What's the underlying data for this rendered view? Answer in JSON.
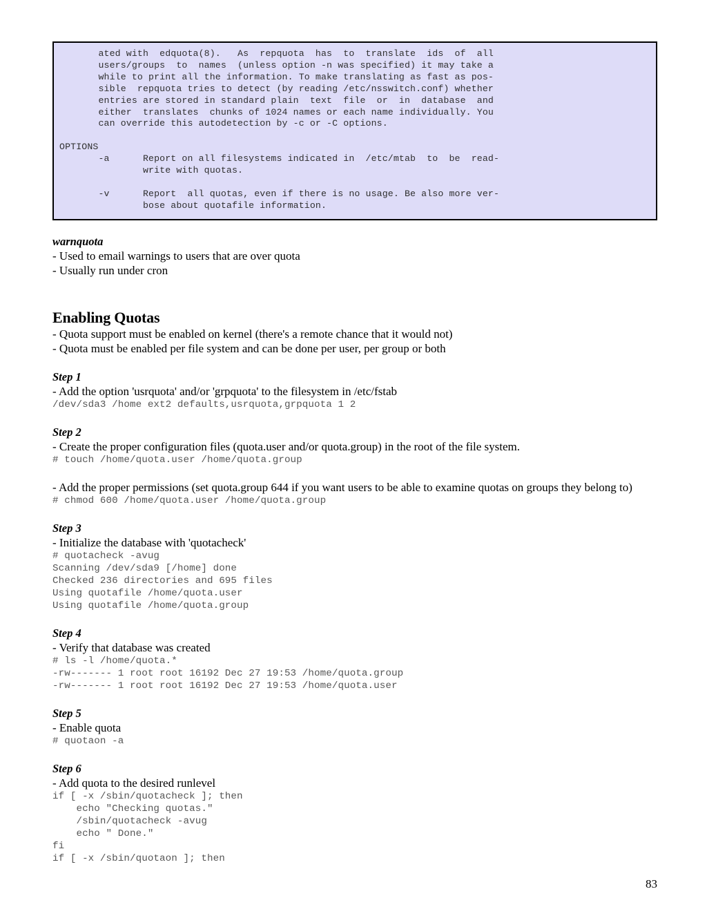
{
  "page": {
    "number": "83"
  },
  "manpage_box": {
    "name": "repquota-manpage-excerpt",
    "background_color": "#dedcf8",
    "border_color": "#000000",
    "text": "       ated with  edquota(8).   As  repquota  has  to  translate  ids  of  all\n       users/groups  to  names  (unless option -n was specified) it may take a\n       while to print all the information. To make translating as fast as pos-\n       sible  repquota tries to detect (by reading /etc/nsswitch.conf) whether\n       entries are stored in standard plain  text  file  or  in  database  and\n       either  translates  chunks of 1024 names or each name individually. You\n       can override this autodetection by -c or -C options.\n\nOPTIONS\n       -a      Report on all filesystems indicated in  /etc/mtab  to  be  read-\n               write with quotas.\n\n       -v      Report  all quotas, even if there is no usage. Be also more ver-\n               bose about quotafile information."
  },
  "warnquota": {
    "heading": "warnquota",
    "bullets": [
      "- Used to email warnings to users that are over quota",
      "- Usually run under cron"
    ]
  },
  "enabling_quotas": {
    "heading": "Enabling Quotas",
    "bullets": [
      "- Quota support must be enabled on kernel (there's a remote chance that it would not)",
      "- Quota must be enabled per file system and can be done per user, per group or both"
    ]
  },
  "steps": [
    {
      "heading": "Step 1",
      "bullets": [
        "- Add the option 'usrquota' and/or 'grpquota' to the filesystem in /etc/fstab"
      ],
      "terminal": "/dev/sda3 /home ext2 defaults,usrquota,grpquota 1 2"
    },
    {
      "heading": "Step 2",
      "bullets": [
        "- Create the proper configuration files (quota.user and/or quota.group) in the root of the file system."
      ],
      "terminal": "# touch /home/quota.user /home/quota.group"
    },
    {
      "heading": "",
      "bullets": [
        "- Add the proper permissions (set quota.group 644 if you want users to be able to examine quotas on groups they belong to)"
      ],
      "terminal": "# chmod 600 /home/quota.user /home/quota.group"
    },
    {
      "heading": "Step 3",
      "bullets": [
        "- Initialize the database with 'quotacheck'"
      ],
      "terminal": "# quotacheck -avug\nScanning /dev/sda9 [/home] done\nChecked 236 directories and 695 files\nUsing quotafile /home/quota.user\nUsing quotafile /home/quota.group"
    },
    {
      "heading": "Step 4",
      "bullets": [
        "- Verify that database was created"
      ],
      "terminal": "# ls -l /home/quota.*\n-rw------- 1 root root 16192 Dec 27 19:53 /home/quota.group\n-rw------- 1 root root 16192 Dec 27 19:53 /home/quota.user"
    },
    {
      "heading": "Step 5",
      "bullets": [
        "- Enable quota"
      ],
      "terminal": "# quotaon -a"
    },
    {
      "heading": "Step 6",
      "bullets": [
        "- Add quota to the desired runlevel"
      ],
      "terminal": "if [ -x /sbin/quotacheck ]; then\n    echo \"Checking quotas.\"\n    /sbin/quotacheck -avug\n    echo \" Done.\"\nfi\nif [ -x /sbin/quotaon ]; then"
    }
  ]
}
